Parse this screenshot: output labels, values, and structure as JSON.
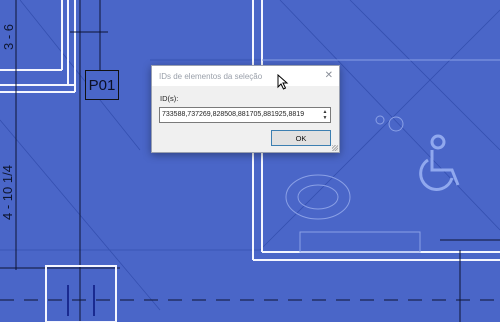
{
  "drawing": {
    "dimension_top": "3 - 6",
    "dimension_side": "4 - 10 1/4",
    "tag_label": "P01"
  },
  "dialog": {
    "title": "IDs de elementos da seleção",
    "close_glyph": "✕",
    "ids_label": "ID(s):",
    "ids_value": "733588,737269,828508,881705,881925,8819",
    "ok_label": "OK"
  },
  "colors": {
    "canvas_blue": "#4a66c8",
    "dialog_bg": "#f0f0f0",
    "ok_border": "#3c7fb1"
  }
}
